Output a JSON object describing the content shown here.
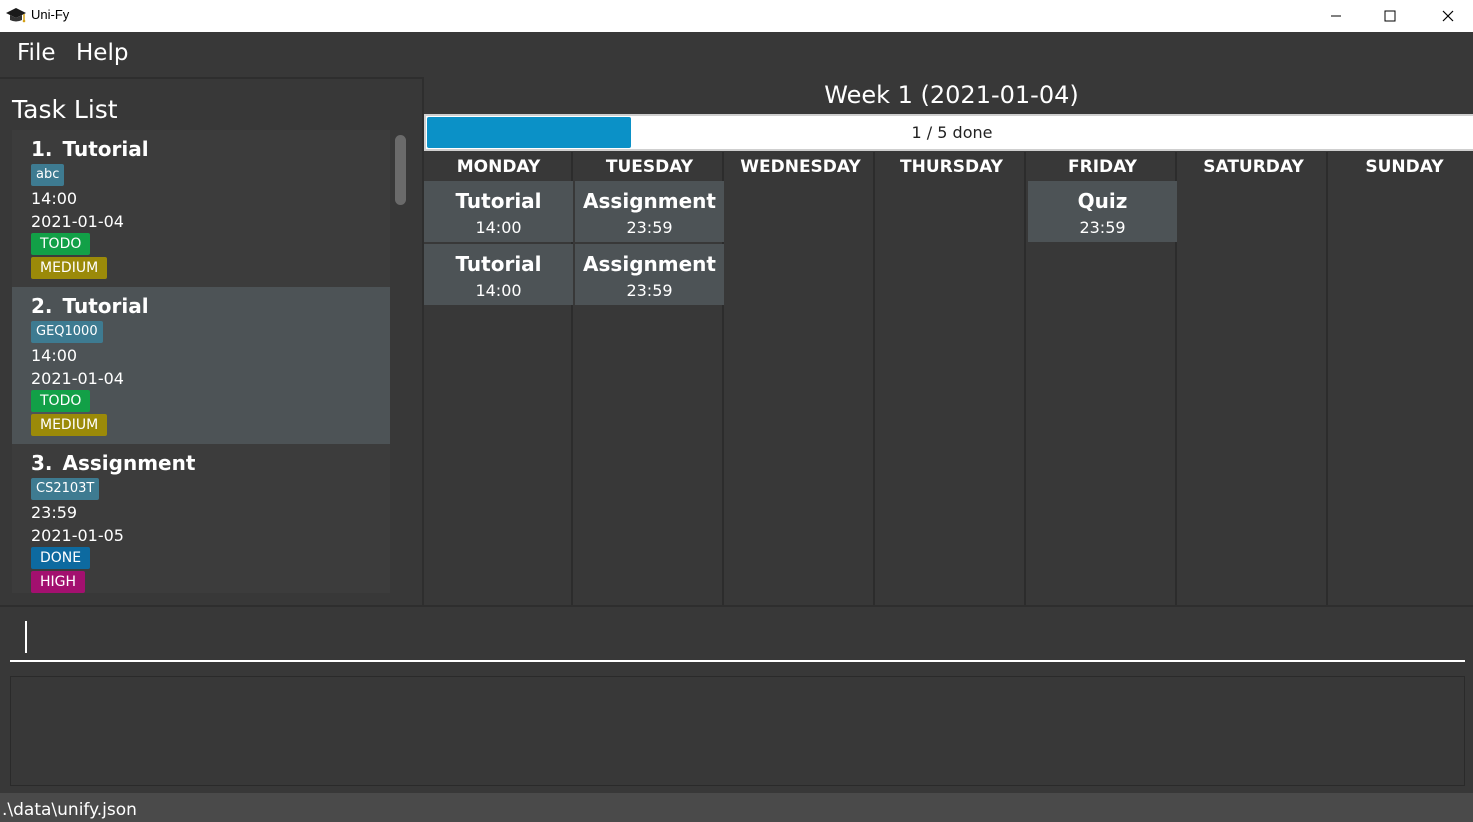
{
  "window": {
    "title": "Uni-Fy",
    "icon": "graduation-cap-icon"
  },
  "menu": {
    "file": "File",
    "help": "Help"
  },
  "task_panel": {
    "title": "Task List",
    "tasks": [
      {
        "index": "1.",
        "name": "Tutorial",
        "tag": "abc",
        "time": "14:00",
        "date": "2021-01-04",
        "status": "TODO",
        "priority": "MEDIUM"
      },
      {
        "index": "2.",
        "name": "Tutorial",
        "tag": "GEQ1000",
        "time": "14:00",
        "date": "2021-01-04",
        "status": "TODO",
        "priority": "MEDIUM"
      },
      {
        "index": "3.",
        "name": "Assignment",
        "tag": "CS2103T",
        "time": "23:59",
        "date": "2021-01-05",
        "status": "DONE",
        "priority": "HIGH"
      }
    ]
  },
  "calendar": {
    "week_title": "Week 1 (2021-01-04)",
    "progress_text": "1 / 5 done",
    "progress_fraction": 0.2,
    "days": [
      {
        "name": "MONDAY",
        "events": [
          {
            "name": "Tutorial",
            "time": "14:00"
          },
          {
            "name": "Tutorial",
            "time": "14:00"
          }
        ]
      },
      {
        "name": "TUESDAY",
        "events": [
          {
            "name": "Assignment",
            "time": "23:59"
          },
          {
            "name": "Assignment",
            "time": "23:59"
          }
        ]
      },
      {
        "name": "WEDNESDAY",
        "events": []
      },
      {
        "name": "THURSDAY",
        "events": []
      },
      {
        "name": "FRIDAY",
        "events": [
          {
            "name": "Quiz",
            "time": "23:59"
          }
        ]
      },
      {
        "name": "SATURDAY",
        "events": []
      },
      {
        "name": "SUNDAY",
        "events": []
      }
    ]
  },
  "command": {
    "value": "",
    "result": ""
  },
  "status_bar": {
    "path": ".\\data\\unify.json"
  },
  "colors": {
    "todo": "#12a047",
    "done": "#0d6aa0",
    "medium": "#9b8a09",
    "high": "#a3106f",
    "module_tag": "#3e7b91",
    "progress": "#0b91c7"
  }
}
